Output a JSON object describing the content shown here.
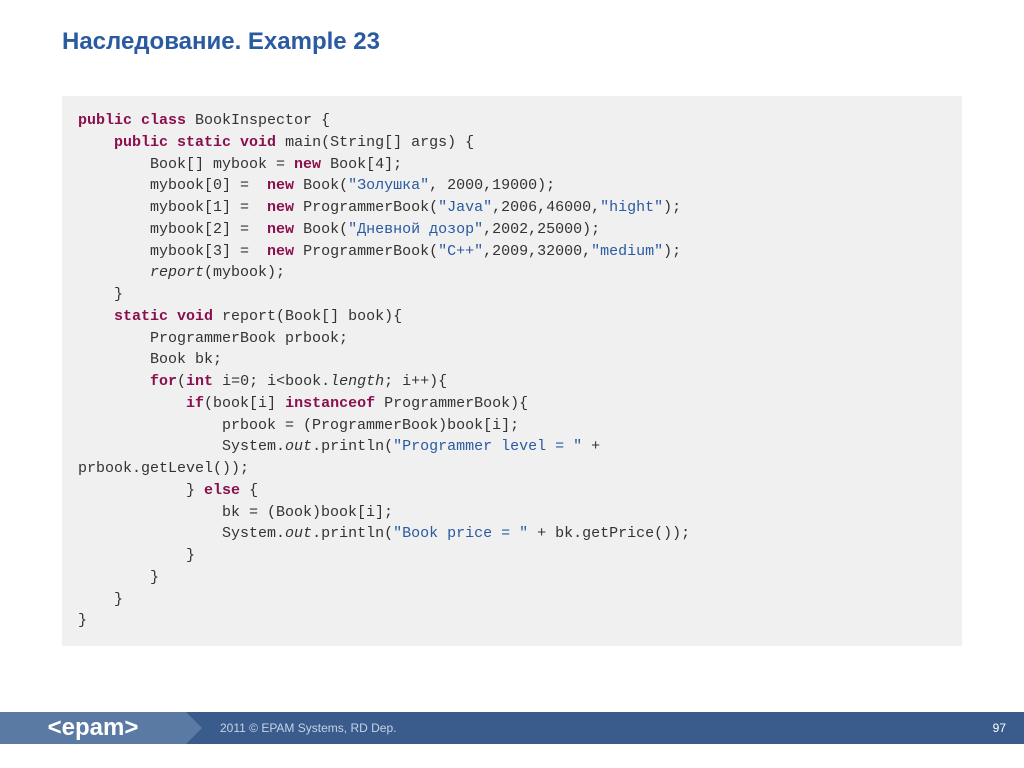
{
  "title": "Наследование. Example 23",
  "code": {
    "l1a": "public",
    "l1b": " class",
    "l1c": " BookInspector {",
    "l2a": "public",
    "l2b": " static",
    "l2c": " void",
    "l2d": " main(String[] args) {",
    "l3a": "Book[] mybook = ",
    "l3b": "new",
    "l3c": " Book[4];",
    "l4a": "mybook[0] =  ",
    "l4b": "new",
    "l4c": " Book(",
    "l4d": "\"Золушка\"",
    "l4e": ", 2000,19000);",
    "l5a": "mybook[1] =  ",
    "l5b": "new",
    "l5c": " ProgrammerBook(",
    "l5d": "\"Java\"",
    "l5e": ",2006,46000,",
    "l5f": "\"hight\"",
    "l5g": ");",
    "l6a": "mybook[2] =  ",
    "l6b": "new",
    "l6c": " Book(",
    "l6d": "\"Дневной дозор\"",
    "l6e": ",2002,25000);",
    "l7a": "mybook[3] =  ",
    "l7b": "new",
    "l7c": " ProgrammerBook(",
    "l7d": "\"C++\"",
    "l7e": ",2009,32000,",
    "l7f": "\"medium\"",
    "l7g": ");",
    "l8a": "report",
    "l8b": "(mybook);",
    "l9": "}",
    "l10a": "static",
    "l10b": " void",
    "l10c": " report(Book[] book){",
    "l11": "ProgrammerBook prbook;",
    "l12": "Book bk;",
    "l13a": "for",
    "l13b": "(",
    "l13c": "int",
    "l13d": " i=0; i<book.",
    "l13e": "length",
    "l13f": "; i++){",
    "l14a": "if",
    "l14b": "(book[i] ",
    "l14c": "instanceof",
    "l14d": " ProgrammerBook){",
    "l15": "prbook = (ProgrammerBook)book[i];",
    "l16a": "System.",
    "l16b": "out",
    "l16c": ".println(",
    "l16d": "\"Programmer level = \"",
    "l16e": " +",
    "l17": "prbook.getLevel());",
    "l18a": "} ",
    "l18b": "else",
    "l18c": " {",
    "l19": "bk = (Book)book[i];",
    "l20a": "System.",
    "l20b": "out",
    "l20c": ".println(",
    "l20d": "\"Book price = \"",
    "l20e": " + bk.getPrice());",
    "l21": "}",
    "l22": "}",
    "l23": "}",
    "l24": "}"
  },
  "footer": {
    "logo": "<epam>",
    "copyright": "2011 © EPAM Systems, RD Dep.",
    "page": "97"
  }
}
